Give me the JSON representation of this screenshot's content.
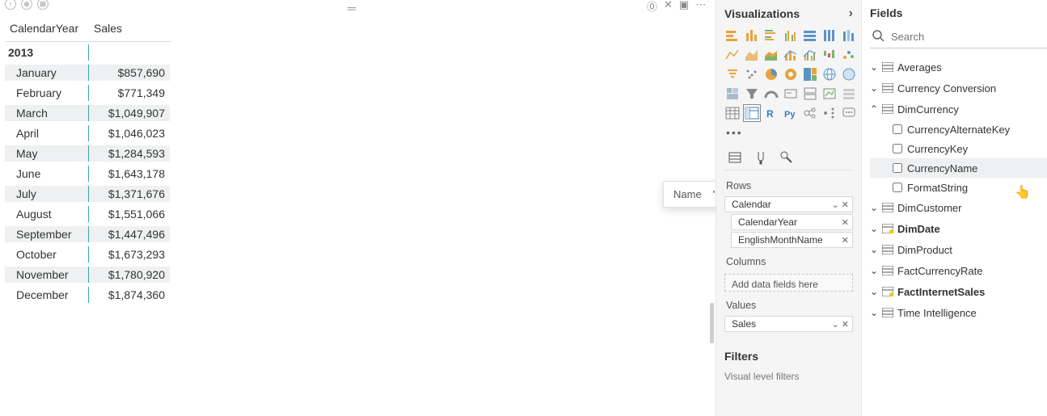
{
  "top_icons": {
    "a": "↑",
    "b": "⊕",
    "c": "⊞"
  },
  "matrix": {
    "headers": {
      "c1": "CalendarYear",
      "c2": "Sales"
    },
    "year": "2013",
    "rows": [
      {
        "month": "January",
        "sales": "$857,690"
      },
      {
        "month": "February",
        "sales": "$771,349"
      },
      {
        "month": "March",
        "sales": "$1,049,907"
      },
      {
        "month": "April",
        "sales": "$1,046,023"
      },
      {
        "month": "May",
        "sales": "$1,284,593"
      },
      {
        "month": "June",
        "sales": "$1,643,178"
      },
      {
        "month": "July",
        "sales": "$1,371,676"
      },
      {
        "month": "August",
        "sales": "$1,551,066"
      },
      {
        "month": "September",
        "sales": "$1,447,496"
      },
      {
        "month": "October",
        "sales": "$1,673,293"
      },
      {
        "month": "November",
        "sales": "$1,780,920"
      },
      {
        "month": "December",
        "sales": "$1,874,360"
      }
    ]
  },
  "viz": {
    "title": "Visualizations",
    "rows_label": "Rows",
    "rows_field": "Calendar",
    "rows_child1": "CalendarYear",
    "rows_child2": "EnglishMonthName",
    "columns_label": "Columns",
    "columns_placeholder": "Add data fields here",
    "values_label": "Values",
    "values_field": "Sales",
    "filters_title": "Filters",
    "filters_sub": "Visual level filters"
  },
  "fields": {
    "title": "Fields",
    "search_placeholder": "Search",
    "tables": {
      "t0": "Averages",
      "t1": "Currency Conversion",
      "t2": "DimCurrency",
      "t2_cols": {
        "c0": "CurrencyAlternateKey",
        "c1": "CurrencyKey",
        "c2": "CurrencyName",
        "c3": "FormatString"
      },
      "t3": "DimCustomer",
      "t4": "DimDate",
      "t5": "DimProduct",
      "t6": "FactCurrencyRate",
      "t7": "FactInternetSales",
      "t8": "Time Intelligence"
    }
  },
  "tooltip": {
    "label": "Name",
    "value": "'DimCurrency'[CurrencyName]"
  }
}
